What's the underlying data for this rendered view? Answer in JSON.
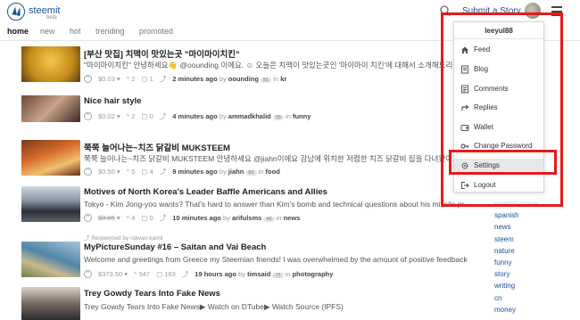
{
  "header": {
    "brand": "steemit",
    "beta": "beta",
    "submit_label": "Submit a Story"
  },
  "tabs": [
    "home",
    "new",
    "hot",
    "trending",
    "promoted"
  ],
  "posts": [
    {
      "title": "[부산 맛집] 치맥이 맛있는곳 \"마이마이치킨\"",
      "body": "\"마이마이치킨\" 안녕하세요👋 @oounding 이에요. ☺ 오늘은 치맥이 맛있는곳인 '마이마이 치킨'에 대해서 소개해드리려고",
      "payout": "$0.03",
      "votes": "2",
      "comments": "1",
      "time": "2 minutes ago",
      "author": "oounding",
      "rep": "51",
      "category": "kr",
      "resteem": ""
    },
    {
      "title": "Nice hair style",
      "body": "",
      "payout": "$0.02",
      "votes": "2",
      "comments": "0",
      "time": "4 minutes ago",
      "author": "ammadkhalid",
      "rep": "55",
      "category": "funny",
      "resteem": ""
    },
    {
      "title": "쭉쭉 늘어나는~치즈 닭갈비 MUKSTEEM",
      "body": "쭉쭉 늘어나는~치즈 닭갈비 MUKSTEEM 안녕하세요 @jiahn이에요 강남에 위치한 저렴한 치즈 닭갈비 집을 다녀왔어요",
      "payout": "$0.50",
      "votes": "5",
      "comments": "4",
      "time": "9 minutes ago",
      "author": "jiahn",
      "rep": "60",
      "category": "food",
      "resteem": ""
    },
    {
      "title": "Motives of North Korea's Leader Baffle Americans and Allies",
      "body": "Tokyo - Kim Jong-yoo wants? That's hard to answer than Kim's bomb and technical questions about his missile pr",
      "payout": "$0.05",
      "votes": "4",
      "comments": "0",
      "time": "10 minutes ago",
      "author": "arifulsms",
      "rep": "46",
      "category": "news",
      "resteem": ""
    },
    {
      "title": "MyPictureSunday #16 – Saitan and Vai Beach",
      "body": "Welcome and greetings from Greece my Steemian friends! I was overwhelmed by the amount of positive feedback fo",
      "payout": "$373.50",
      "votes": "547",
      "comments": "163",
      "time": "19 hours ago",
      "author": "timsaid",
      "rep": "72",
      "category": "photography",
      "resteem": "Resteemed by ridwan-kamil"
    },
    {
      "title": "Trey Gowdy Tears Into Fake News",
      "body": "Trey Gowdy Tears Into Fake News▶ Watch on DTube▶ Watch Source (IPFS)",
      "payout": "",
      "votes": "",
      "comments": "",
      "time": "",
      "author": "",
      "rep": "",
      "category": "",
      "resteem": ""
    }
  ],
  "sidebar_tags": [
    "steemit-crave",
    "spanish",
    "news",
    "steem",
    "nature",
    "funny",
    "story",
    "writing",
    "cn",
    "money"
  ],
  "menu": {
    "username": "leeyul88",
    "items": [
      "Feed",
      "Blog",
      "Comments",
      "Replies",
      "Wallet",
      "Change Password",
      "Settings",
      "Logout"
    ],
    "selected": "Settings"
  },
  "colors": {
    "brand": "#1a5099",
    "highlight": "#e31b1b",
    "link": "#1a5099"
  }
}
